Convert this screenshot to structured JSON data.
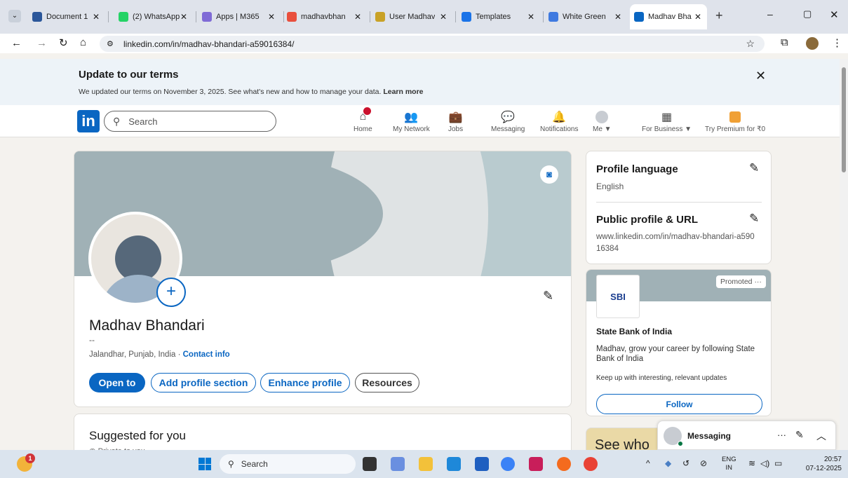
{
  "browser": {
    "tabs": [
      {
        "label": "Document 1",
        "color": "#2b579a"
      },
      {
        "label": "(2) WhatsApp",
        "color": "#25d366",
        "badge": "2"
      },
      {
        "label": "Apps | M365",
        "color": "#7f6bd6"
      },
      {
        "label": "madhavbhan",
        "color": "#e94f3d"
      },
      {
        "label": "User Madhav",
        "color": "#c9a227"
      },
      {
        "label": "Templates",
        "color": "#1a73e8"
      },
      {
        "label": "White Green",
        "color": "#3f7ae0"
      },
      {
        "label": "Madhav Bha",
        "color": "#0a66c2"
      }
    ],
    "url": "linkedin.com/in/madhav-bhandari-a59016384/"
  },
  "banner": {
    "title": "Update to our terms",
    "text": "We updated our terms on November 3, 2025. See what's new and how to manage your data.",
    "link": "Learn more"
  },
  "nav": {
    "search_placeholder": "Search",
    "items": [
      {
        "label": "Home"
      },
      {
        "label": "My Network"
      },
      {
        "label": "Jobs"
      },
      {
        "label": "Messaging"
      },
      {
        "label": "Notifications"
      },
      {
        "label": "Me ▼"
      },
      {
        "label": "For Business ▼"
      },
      {
        "label": "Try Premium for ₹0"
      }
    ]
  },
  "profile": {
    "name": "Madhav Bhandari",
    "headline": "--",
    "location": "Jalandhar, Punjab, India · ",
    "contact": "Contact info",
    "buttons": [
      "Open to",
      "Add profile section",
      "Enhance profile",
      "Resources"
    ]
  },
  "suggested": {
    "title": "Suggested for you",
    "sub": "Private to you"
  },
  "sidebar": {
    "lang_title": "Profile language",
    "lang_value": "English",
    "url_title": "Public profile & URL",
    "url_value": "www.linkedin.com/in/madhav-bhandari-a59016384"
  },
  "ad": {
    "promoted": "Promoted ···",
    "logo": "SBI",
    "company": "State Bank of India",
    "line1": "Madhav, grow your career by following State Bank of India",
    "line2": "Keep up with interesting, relevant updates",
    "follow": "Follow",
    "peek": "See who"
  },
  "messaging": {
    "label": "Messaging"
  },
  "taskbar": {
    "search": "Search",
    "lang1": "ENG",
    "lang2": "IN",
    "time": "20:57",
    "date": "07-12-2025",
    "notif": "1"
  }
}
